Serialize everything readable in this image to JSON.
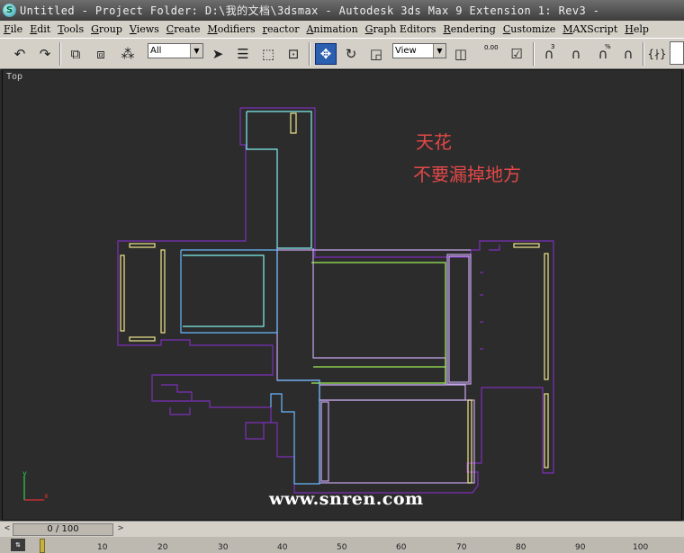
{
  "window": {
    "title": "Untitled     - Project Folder: D:\\我的文档\\3dsmax     - Autodesk 3ds Max 9 Extension 1: Rev3     - ",
    "icon_letter": "S"
  },
  "menu": [
    "File",
    "Edit",
    "Tools",
    "Group",
    "Views",
    "Create",
    "Modifiers",
    "reactor",
    "Animation",
    "Graph Editors",
    "Rendering",
    "Customize",
    "MAXScript",
    "Help"
  ],
  "toolbar": {
    "selection_filter": "All",
    "reference_coord": "View",
    "spinner_value": "0.00",
    "snap_angle": "3",
    "snap_percent": "%"
  },
  "viewport": {
    "label": "Top",
    "annotation_line1": "天花",
    "annotation_line2": "不要漏掉地方",
    "watermark": "www.snren.com",
    "axis_x": "x",
    "axis_y": "y"
  },
  "timeline": {
    "position": "0 / 100",
    "ticks": [
      "10",
      "20",
      "30",
      "40",
      "50",
      "60",
      "70",
      "80",
      "90",
      "100"
    ]
  },
  "colors": {
    "wall": "#7b2fb8",
    "cyan": "#7ff0f0",
    "green": "#9ff05a",
    "yellow": "#f0e68c",
    "lavender": "#c8a8f0",
    "blue": "#6ab8ff",
    "annotation": "#e24848"
  }
}
